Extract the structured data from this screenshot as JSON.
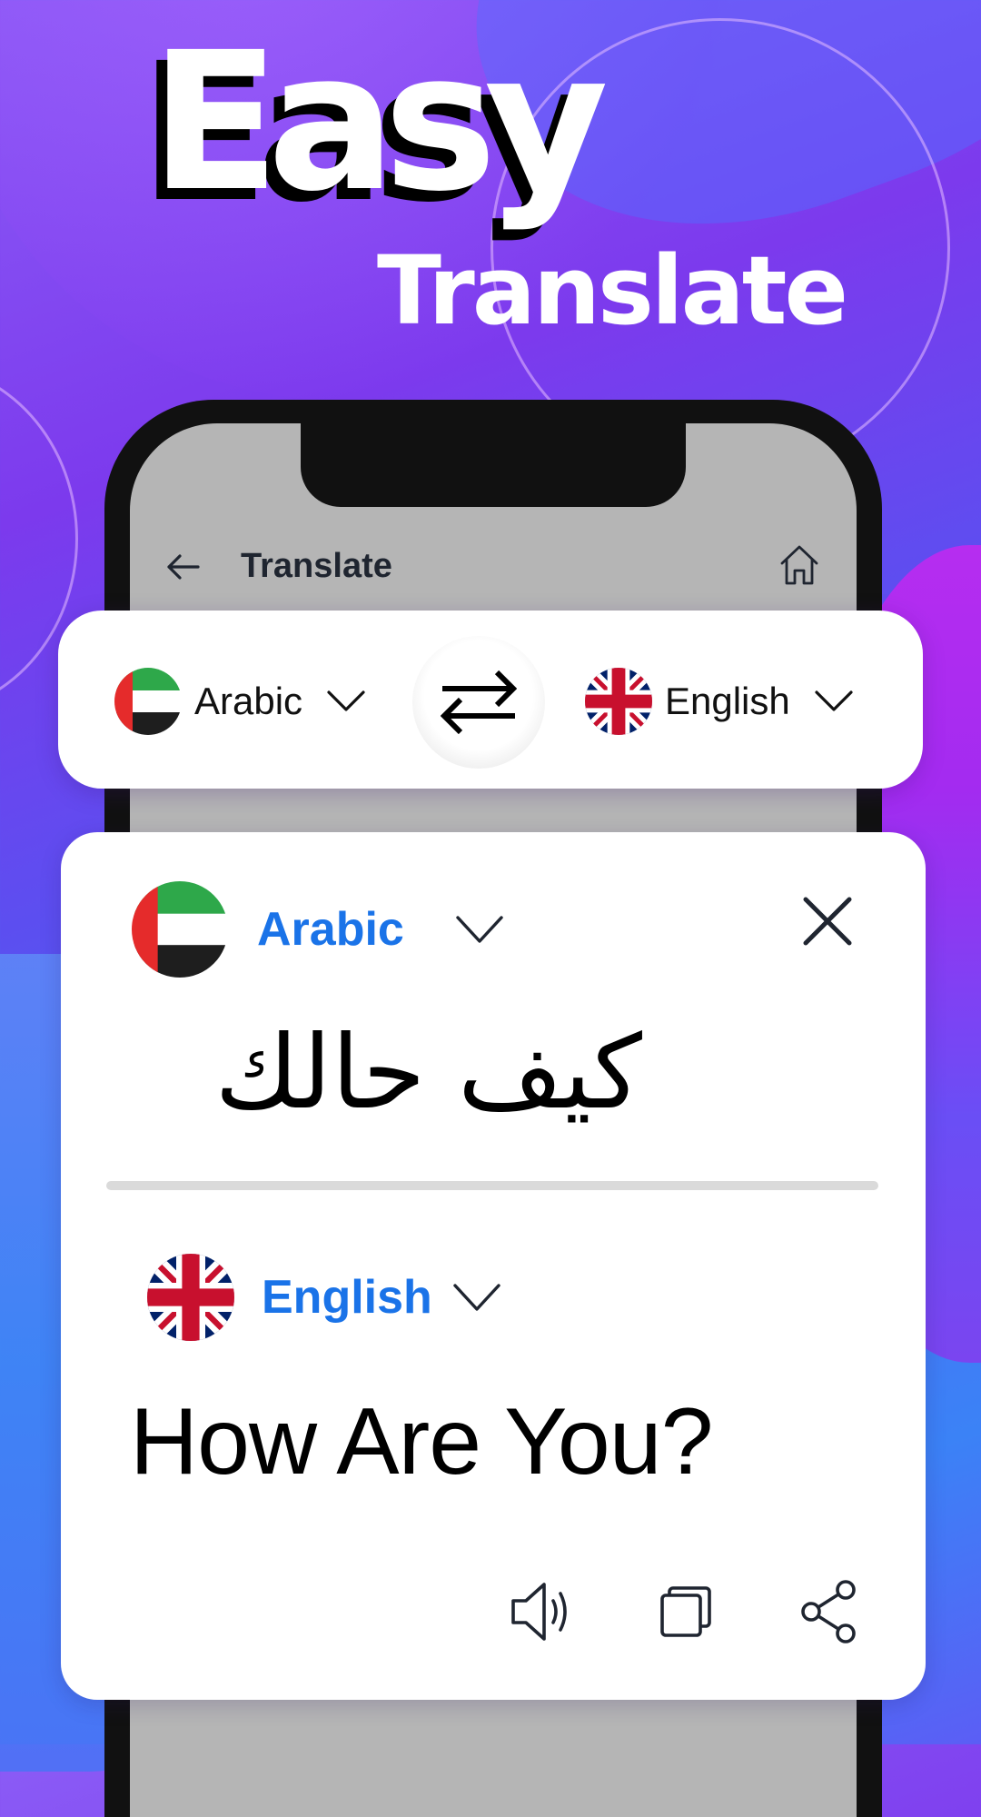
{
  "promo": {
    "headline_primary": "Easy",
    "headline_secondary": "Translate"
  },
  "app_bar": {
    "title": "Translate",
    "back_icon": "arrow-left-icon",
    "home_icon": "home-icon"
  },
  "language_bar": {
    "source": {
      "name": "Arabic",
      "flag": "uae-flag"
    },
    "target": {
      "name": "English",
      "flag": "uk-flag"
    },
    "swap_icon": "swap-arrows-icon"
  },
  "translation": {
    "source_language": "Arabic",
    "source_text": "كيف حالك",
    "target_language": "English",
    "target_text": "How Are You?",
    "actions": [
      "speaker-icon",
      "copy-icon",
      "share-icon"
    ]
  },
  "colors": {
    "accent": "#1a73e8",
    "icon": "#1f2530",
    "phone_frame": "#111111",
    "phone_screen": "#b5b5b5"
  }
}
